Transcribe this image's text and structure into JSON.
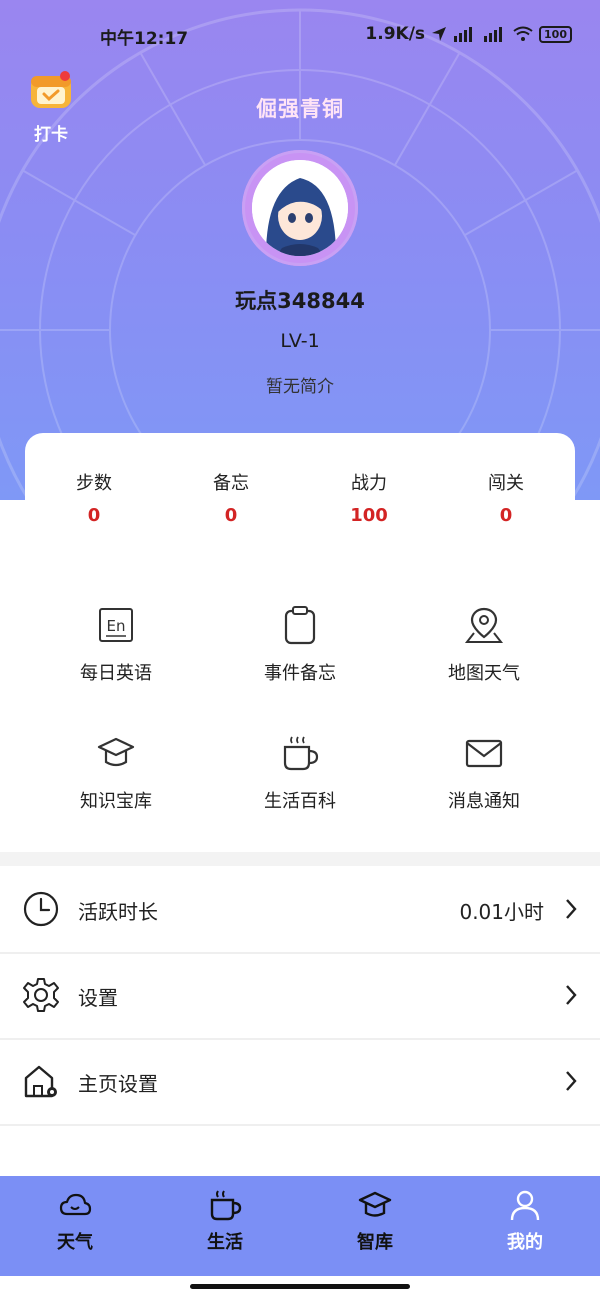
{
  "status_bar": {
    "time": "中午12:17",
    "network_speed": "1.9K/s",
    "battery": "100"
  },
  "header": {
    "checkin_label": "打卡",
    "rank_title": "倔强青铜",
    "nickname": "玩点348844",
    "level": "LV-1",
    "intro": "暂无简介"
  },
  "stats": [
    {
      "label": "步数",
      "value": "0"
    },
    {
      "label": "备忘",
      "value": "0"
    },
    {
      "label": "战力",
      "value": "100"
    },
    {
      "label": "闯关",
      "value": "0"
    }
  ],
  "features": [
    {
      "label": "每日英语",
      "icon": "english-icon"
    },
    {
      "label": "事件备忘",
      "icon": "clipboard-icon"
    },
    {
      "label": "地图天气",
      "icon": "map-pin-icon"
    },
    {
      "label": "知识宝库",
      "icon": "graduation-cap-icon"
    },
    {
      "label": "生活百科",
      "icon": "coffee-cup-icon"
    },
    {
      "label": "消息通知",
      "icon": "mail-icon"
    }
  ],
  "settings_rows": [
    {
      "label": "活跃时长",
      "value": "0.01小时",
      "icon": "clock-icon"
    },
    {
      "label": "设置",
      "value": "",
      "icon": "gear-icon"
    },
    {
      "label": "主页设置",
      "value": "",
      "icon": "home-settings-icon"
    }
  ],
  "tabs": [
    {
      "label": "天气",
      "icon": "cloud-icon"
    },
    {
      "label": "生活",
      "icon": "coffee-cup-icon"
    },
    {
      "label": "智库",
      "icon": "graduation-cap-icon"
    },
    {
      "label": "我的",
      "icon": "person-icon",
      "active": true
    }
  ],
  "colors": {
    "header_gradient_top": "#9a86f0",
    "header_gradient_bottom": "#7f98f6",
    "tabbar": "#7b8ff5",
    "stat_value": "#d32424",
    "rank_title": "#ffe4f6"
  }
}
